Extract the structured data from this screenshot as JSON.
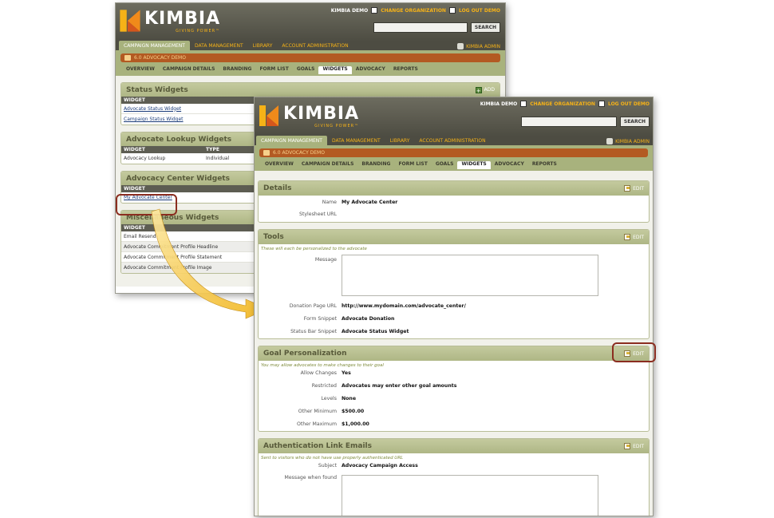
{
  "header": {
    "logo_word": "KIMBIA",
    "logo_tagline": "GIVING POWER™",
    "account_name": "KIMBIA DEMO",
    "change_org_label": "CHANGE ORGANIZATION",
    "logout_label": "LOG OUT DEMO",
    "search_button": "SEARCH",
    "search_value": "",
    "admin_label": "KIMBIA ADMIN"
  },
  "nav": [
    {
      "label": "CAMPAIGN MANAGEMENT",
      "active": true
    },
    {
      "label": "DATA MANAGEMENT",
      "active": false
    },
    {
      "label": "LIBRARY",
      "active": false
    },
    {
      "label": "ACCOUNT ADMINISTRATION",
      "active": false
    }
  ],
  "campaign": {
    "name": "6.0 ADVOCACY DEMO"
  },
  "subnav": [
    {
      "label": "OVERVIEW",
      "active": false
    },
    {
      "label": "CAMPAIGN DETAILS",
      "active": false
    },
    {
      "label": "BRANDING",
      "active": false
    },
    {
      "label": "FORM LIST",
      "active": false
    },
    {
      "label": "GOALS",
      "active": false
    },
    {
      "label": "WIDGETS",
      "active": true
    },
    {
      "label": "ADVOCACY",
      "active": false
    },
    {
      "label": "REPORTS",
      "active": false
    }
  ],
  "back": {
    "add_label": "ADD",
    "status_widgets": {
      "title": "Status Widgets",
      "col": "WIDGET",
      "rows": [
        "Advocate Status Widget",
        "Campaign Status Widget"
      ]
    },
    "lookup_widgets": {
      "title": "Advocate Lookup Widgets",
      "col_widget": "WIDGET",
      "col_type": "TYPE",
      "rows": [
        {
          "widget": "Advocacy Lookup",
          "type": "Individual"
        }
      ]
    },
    "center_widgets": {
      "title": "Advocacy Center Widgets",
      "col": "WIDGET",
      "rows": [
        "My Advocate Center"
      ]
    },
    "misc_widgets": {
      "title": "Miscellaneous Widgets",
      "col": "WIDGET",
      "rows": [
        "Email Resend",
        "Advocate Commitment Profile Headline",
        "Advocate Commitment Profile Statement",
        "Advocate Commitment Profile Image"
      ]
    }
  },
  "front": {
    "edit_label": "EDIT",
    "details": {
      "title": "Details",
      "name_label": "Name",
      "name_value": "My Advocate Center",
      "stylesheet_label": "Stylesheet URL",
      "stylesheet_value": ""
    },
    "tools": {
      "title": "Tools",
      "hint": "These will each be personalized to the advocate",
      "message_label": "Message",
      "donation_url_label": "Donation Page URL",
      "donation_url_value": "http://www.mydomain.com/advocate_center/",
      "form_snippet_label": "Form Snippet",
      "form_snippet_value": "Advocate Donation",
      "status_bar_label": "Status Bar Snippet",
      "status_bar_value": "Advocate Status Widget"
    },
    "goal": {
      "title": "Goal Personalization",
      "hint": "You may allow advocates to make changes to their goal",
      "allow_label": "Allow Changes",
      "allow_value": "Yes",
      "restricted_label": "Restricted",
      "restricted_value": "Advocates may enter other goal amounts",
      "levels_label": "Levels",
      "levels_value": "None",
      "min_label": "Other Minimum",
      "min_value": "$500.00",
      "max_label": "Other Maximum",
      "max_value": "$1,000.00"
    },
    "auth": {
      "title": "Authentication Link Emails",
      "hint": "Sent to visitors who do not have use properly authenticated URL",
      "subject_label": "Subject",
      "subject_value": "Advocacy Campaign Access",
      "message_found_label": "Message when found"
    }
  },
  "colors": {
    "header_bg": "#5d5c50",
    "accent_gold": "#f6b217",
    "panel_title_bg": "#aeb685",
    "campaign_bar": "#b35a22",
    "highlight": "#8b2d20",
    "arrow": "#f2b51c"
  }
}
